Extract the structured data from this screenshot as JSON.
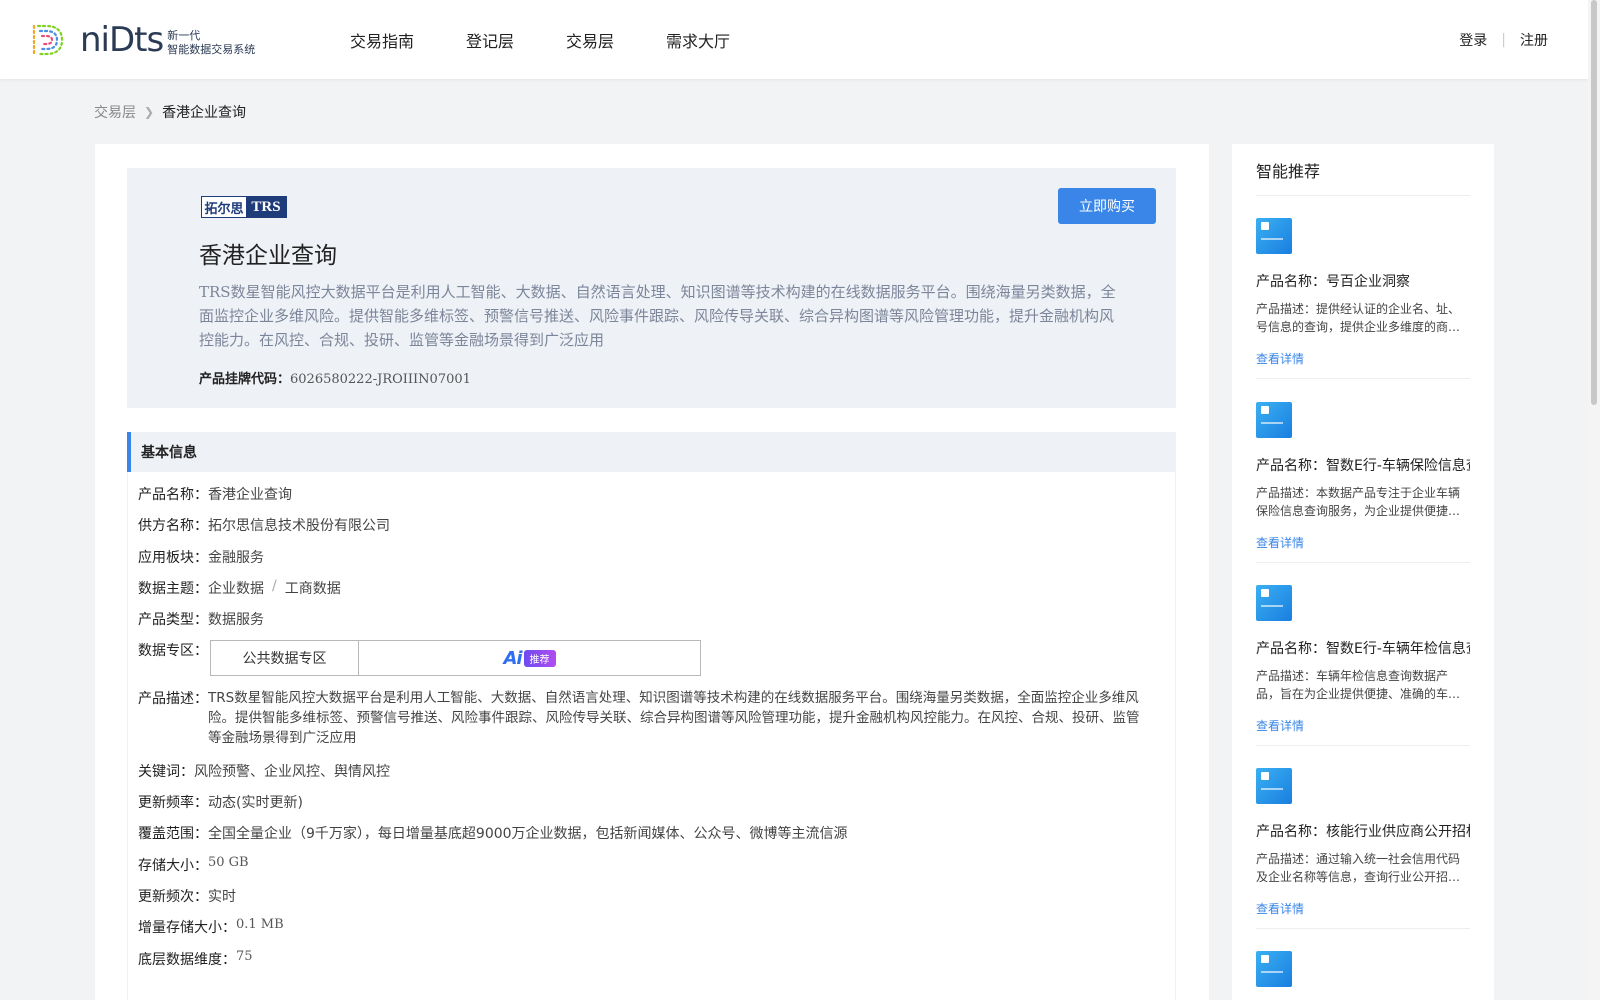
{
  "header": {
    "logo_word": "niDts",
    "logo_sub_line1": "新一代",
    "logo_sub_line2": "智能数据交易系统",
    "nav": [
      "交易指南",
      "登记层",
      "交易层",
      "需求大厅"
    ],
    "login": "登录",
    "register": "注册"
  },
  "breadcrumb": {
    "parent": "交易层",
    "current": "香港企业查询"
  },
  "hero": {
    "brand_cn": "拓尔思",
    "brand_en": "TRS",
    "buy_label": "立即购买",
    "title": "香港企业查询",
    "description": "TRS数星智能风控大数据平台是利用人工智能、大数据、自然语言处理、知识图谱等技术构建的在线数据服务平台。围绕海量另类数据，全面监控企业多维风险。提供智能多维标签、预警信号推送、风险事件跟踪、风险传导关联、综合异构图谱等风险管理功能，提升金融机构风控能力。在风控、合规、投研、监管等金融场景得到广泛应用",
    "code_label": "产品挂牌代码：",
    "code_value": "6026580222-JROIIIN07001"
  },
  "section_title": "基本信息",
  "info": {
    "name_label": "产品名称：",
    "name": "香港企业查询",
    "supplier_label": "供方名称：",
    "supplier": "拓尔思信息技术股份有限公司",
    "sector_label": "应用板块：",
    "sector": "金融服务",
    "topic_label": "数据主题：",
    "topic_1": "企业数据",
    "topic_sep": "/",
    "topic_2": "工商数据",
    "type_label": "产品类型：",
    "type": "数据服务",
    "zone_label": "数据专区：",
    "zone": "公共数据专区",
    "ai_letters": "Ai",
    "ai_tag": "推荐",
    "desc_label": "产品描述：",
    "desc": "TRS数星智能风控大数据平台是利用人工智能、大数据、自然语言处理、知识图谱等技术构建的在线数据服务平台。围绕海量另类数据，全面监控企业多维风险。提供智能多维标签、预警信号推送、风险事件跟踪、风险传导关联、综合异构图谱等风险管理功能，提升金融机构风控能力。在风控、合规、投研、监管等金融场景得到广泛应用",
    "keywords_label": "关键词：",
    "keywords": "风险预警、企业风控、舆情风控",
    "freq_label": "更新频率：",
    "freq": "动态(实时更新)",
    "coverage_label": "覆盖范围：",
    "coverage": "全国全量企业（9千万家），每日增量基底超9000万企业数据，包括新闻媒体、公众号、微博等主流信源",
    "storage_label": "存储大小：",
    "storage": "50 GB",
    "update_label": "更新频次：",
    "update": "实时",
    "inc_label": "增量存储大小：",
    "inc": "0.1 MB",
    "dim_label": "底层数据维度：",
    "dim": "75"
  },
  "sidebar": {
    "title": "智能推荐",
    "link_label": "查看详情",
    "items": [
      {
        "name": "产品名称：号百企业洞察",
        "desc": "产品描述：提供经认证的企业名、址、号信息的查询，提供企业多维度的商业信息"
      },
      {
        "name": "产品名称：智数E行-车辆保险信息查询",
        "desc": "产品描述：本数据产品专注于企业车辆保险信息查询服务，为企业提供便捷、准确的查询"
      },
      {
        "name": "产品名称：智数E行-车辆年检信息查询",
        "desc": "产品描述：车辆年检信息查询数据产品，旨在为企业提供便捷、准确的车辆年检信息"
      },
      {
        "name": "产品名称：核能行业供应商公开招标信息",
        "desc": "产品描述：通过输入统一社会信用代码及企业名称等信息，查询行业公开招投标信息"
      }
    ]
  },
  "colors": {
    "accent": "#3a86e8",
    "hero_bg": "#eef1f6",
    "page_bg": "#f2f3f5"
  }
}
